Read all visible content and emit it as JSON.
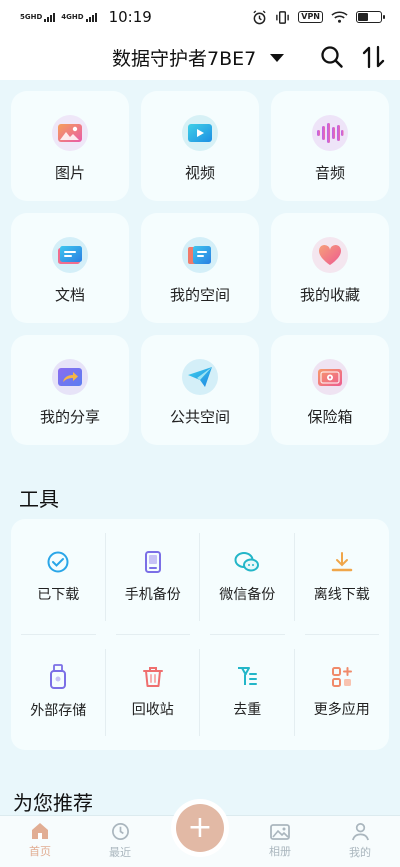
{
  "status_bar": {
    "net1": "5GHD",
    "net2": "4GHD",
    "time": "10:19",
    "vpn": "VPN",
    "battery_level": 0.45
  },
  "header": {
    "account_name": "数据守护者7BE7"
  },
  "categories": [
    {
      "label": "图片",
      "icon": "image-icon",
      "bg": "#efe7f8",
      "color": "#f07a8e"
    },
    {
      "label": "视频",
      "icon": "video-icon",
      "bg": "#d7f1f6",
      "color": "#2ab3e0"
    },
    {
      "label": "音频",
      "icon": "audio-icon",
      "bg": "#eee4f8",
      "color": "#c06bf0"
    },
    {
      "label": "文档",
      "icon": "document-icon",
      "bg": "#d4eff8",
      "color": "#2b9fe6"
    },
    {
      "label": "我的空间",
      "icon": "space-icon",
      "bg": "#d4eff8",
      "color": "#2b9fe6"
    },
    {
      "label": "我的收藏",
      "icon": "heart-icon",
      "bg": "#f4e6ef",
      "color": "#f07095"
    },
    {
      "label": "我的分享",
      "icon": "share-icon",
      "bg": "#e7e3f8",
      "color": "#7c68ee"
    },
    {
      "label": "公共空间",
      "icon": "paper-plane-icon",
      "bg": "#d4eff8",
      "color": "#1fa5e3"
    },
    {
      "label": "保险箱",
      "icon": "safe-box-icon",
      "bg": "#efe3f2",
      "color": "#ef6f8e"
    }
  ],
  "tools_section": {
    "title": "工具",
    "items": [
      {
        "label": "已下载",
        "icon": "downloaded-icon",
        "color": "#2aa6e8"
      },
      {
        "label": "手机备份",
        "icon": "phone-backup-icon",
        "color": "#7b6fe6"
      },
      {
        "label": "微信备份",
        "icon": "wechat-backup-icon",
        "color": "#23b6c8"
      },
      {
        "label": "离线下载",
        "icon": "offline-download-icon",
        "color": "#f0a64a"
      },
      {
        "label": "外部存储",
        "icon": "usb-storage-icon",
        "color": "#7b6fe6"
      },
      {
        "label": "回收站",
        "icon": "trash-icon",
        "color": "#ef6f6f"
      },
      {
        "label": "去重",
        "icon": "dedupe-icon",
        "color": "#23b6c8"
      },
      {
        "label": "更多应用",
        "icon": "more-apps-icon",
        "color": "#f08a6a"
      }
    ]
  },
  "recommend": {
    "title": "为您推荐"
  },
  "bottom_nav": {
    "items": [
      {
        "label": "首页",
        "icon": "home-icon",
        "active": true
      },
      {
        "label": "最近",
        "icon": "clock-icon",
        "active": false
      },
      {
        "label": "相册",
        "icon": "album-icon",
        "active": false
      },
      {
        "label": "我的",
        "icon": "profile-icon",
        "active": false
      }
    ],
    "fab_symbol": "+"
  }
}
